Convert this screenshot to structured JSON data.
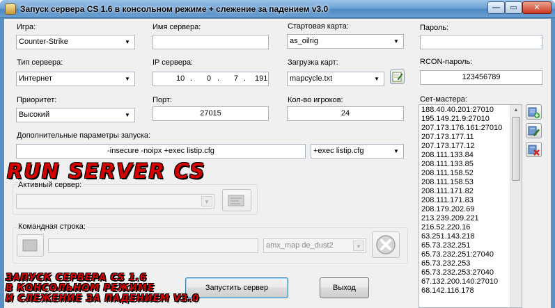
{
  "window": {
    "title": "Запуск сервера CS 1.6 в консольном режиме + слежение за падением v3.0",
    "min_glyph": "—",
    "max_glyph": "▭",
    "close_glyph": "✕"
  },
  "fields": {
    "game": {
      "label": "Игра:",
      "value": "Counter-Strike"
    },
    "server_name": {
      "label": "Имя сервера:",
      "value": ""
    },
    "start_map": {
      "label": "Стартовая карта:",
      "value": "as_oilrig"
    },
    "password": {
      "label": "Пароль:",
      "value": ""
    },
    "server_type": {
      "label": "Тип сервера:",
      "value": "Интернет"
    },
    "ip": {
      "label": "IP сервера:",
      "octets": [
        "10",
        "0",
        "7",
        "191"
      ]
    },
    "map_load": {
      "label": "Загрузка карт:",
      "value": "mapcycle.txt"
    },
    "rcon": {
      "label": "RCON-пароль:",
      "value": "123456789"
    },
    "priority": {
      "label": "Приоритет:",
      "value": "Высокий"
    },
    "port": {
      "label": "Порт:",
      "value": "27015"
    },
    "players": {
      "label": "Кол-во игроков:",
      "value": "24"
    },
    "extra": {
      "label": "Дополнительные параметры запуска:",
      "value": "-insecure -noipx +exec listip.cfg",
      "combo_value": "+exec listip.cfg"
    },
    "active_server": {
      "label": "Активный сервер:",
      "value": ""
    },
    "command_line": {
      "label": "Командная строка:",
      "value": "",
      "combo_value": "amx_map de_dust2"
    }
  },
  "masters": {
    "label": "Сет-мастера:",
    "items": [
      "188.40.40.201:27010",
      "195.149.21.9:27010",
      "207.173.176.161:27010",
      "207.173.177.11",
      "207.173.177.12",
      "208.111.133.84",
      "208.111.133.85",
      "208.111.158.52",
      "208.111.158.53",
      "208.111.171.82",
      "208.111.171.83",
      "208.179.202.69",
      "213.239.209.221",
      "216.52.220.16",
      "63.251.143.218",
      "65.73.232.251",
      "65.73.232.251:27040",
      "65.73.232.253",
      "65.73.232.253:27040",
      "67.132.200.140:27010",
      "68.142.116.178"
    ]
  },
  "buttons": {
    "start": "Запустить сервер",
    "exit": "Выход"
  },
  "banner": {
    "big": "RUN SERVER CS",
    "line1": "ЗАПУСК СЕРВЕРА CS 1.6",
    "line2": "В КОНСОЛЬНОМ РЕЖИМЕ",
    "line3": "И СЛЕЖЕНИЕ ЗА ПАДЕНИЕМ V3.0"
  },
  "icons": {
    "combo_arrow": "▼",
    "scroll_up": "▲",
    "scroll_down": "▼",
    "add": "add-server-icon",
    "edit": "edit-server-icon",
    "delete": "delete-server-icon"
  },
  "colors": {
    "title_blue": "#6fa3d6",
    "banner_red": "#d40000",
    "add_green": "#2aa52a",
    "delete_red": "#d02020"
  }
}
